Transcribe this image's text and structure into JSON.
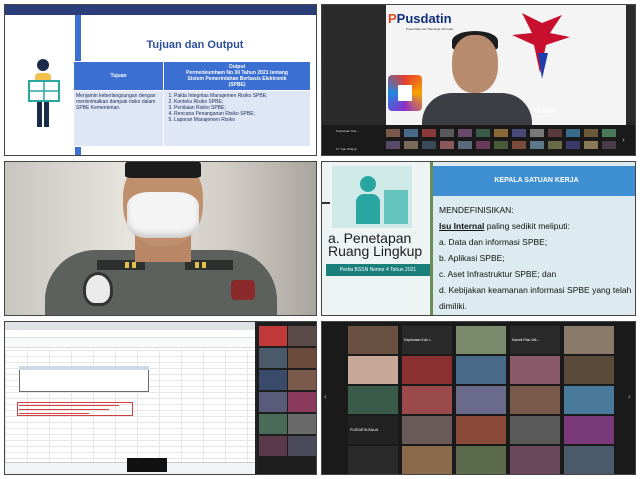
{
  "slide1": {
    "title": "Tujuan dan Output",
    "col_left": "Tujuan",
    "col_right_line1": "Output",
    "col_right_line2": "Permenkumham No 30 Tahun 2021 tentang",
    "col_right_line3": "Sistem Pemerintahan Berbasis Elektronik",
    "col_right_line4": "(SPBE)",
    "tujuan_text": "Menjamin keberlangsungan dengan meminimalkan dampak risiko dalam SPBE Kementerian.",
    "outputs": [
      "Pakta Integritas Manajemen Risiko SPBE;",
      "Konteks Risiko SPBE;",
      "Penilaian Risiko SPBE;",
      "Rencana Penanganan Risiko SPBE;",
      "Laporan Manajemen Risiko"
    ]
  },
  "speaker": {
    "logo_main": "Pusdatin",
    "logo_p": "P",
    "logo_sub": "Pusat Data dan Teknologi Informasi",
    "wbk": "ali WBK",
    "thumb_label_1": "Kepbwaan Kdo...",
    "thumb_label_2": "FT Tgio Whgrgt"
  },
  "slide4": {
    "heading_line1": "a. Penetapan",
    "heading_line2": "Ruang Lingkup",
    "perba": "Perba BSSN Nomor 4 Tahun 2021",
    "header": "KEPALA SATUAN KERJA",
    "mendef": "MENDEFINISIKAN:",
    "isu_u": "Isu Internal",
    "isu_rest": " paling sedikit meliputi:",
    "items": [
      "a. Data dan informasi SPBE;",
      "b. Aplikasi SPBE;",
      "c. Aset Infrastruktur SPBE; dan",
      "d. Kebijakan keamanan informasi SPBE yang telah dimiliki."
    ]
  },
  "gallery": {
    "label_1": "Kepbwaan Kdo l...",
    "label_2": "Kanwil Riau Wk...",
    "label_3": "PUSDATIN BALAI"
  },
  "colors": {
    "slide_blue": "#3b6fd1",
    "teal": "#1b7f7b",
    "header_blue": "#3f8fd3"
  }
}
